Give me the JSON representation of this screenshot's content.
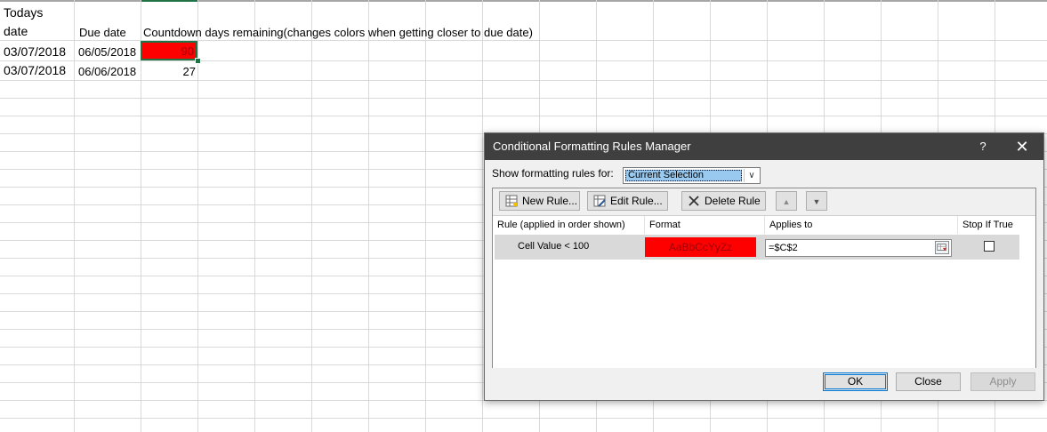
{
  "sheet": {
    "header_a_line1": "Todays",
    "header_a_line2": "date",
    "header_b": "Due date",
    "header_c": "Countdown days remaining(changes colors when getting closer to due date)",
    "rows": [
      {
        "today": "03/07/2018",
        "due": "06/05/2018",
        "countdown": "90",
        "highlight": "#ff0000"
      },
      {
        "today": "03/07/2018",
        "due": "06/06/2018",
        "countdown": "27",
        "highlight": "#ffffff"
      }
    ]
  },
  "dialog": {
    "title": "Conditional Formatting Rules Manager",
    "help": "?",
    "close_glyph": "✕",
    "show_rules_label": "Show formatting rules for:",
    "show_rules_value": "Current Selection",
    "new_rule": "New Rule...",
    "edit_rule": "Edit Rule...",
    "delete_rule": "Delete Rule",
    "move_up": "▲",
    "move_down": "▼",
    "columns": {
      "rule": "Rule (applied in order shown)",
      "format": "Format",
      "applies_to": "Applies to",
      "stop_if_true": "Stop If True"
    },
    "rules": [
      {
        "rule": "Cell Value < 100",
        "format_preview": "AaBbCcYyZz",
        "applies_to": "=$C$2",
        "stop_if_true": false
      }
    ],
    "ok": "OK",
    "close": "Close",
    "apply": "Apply"
  },
  "colors": {
    "highlight_red": "#ff0000",
    "titlebar": "#3f3f3f",
    "selection_blue": "#99c9ef",
    "excel_green": "#217346"
  }
}
